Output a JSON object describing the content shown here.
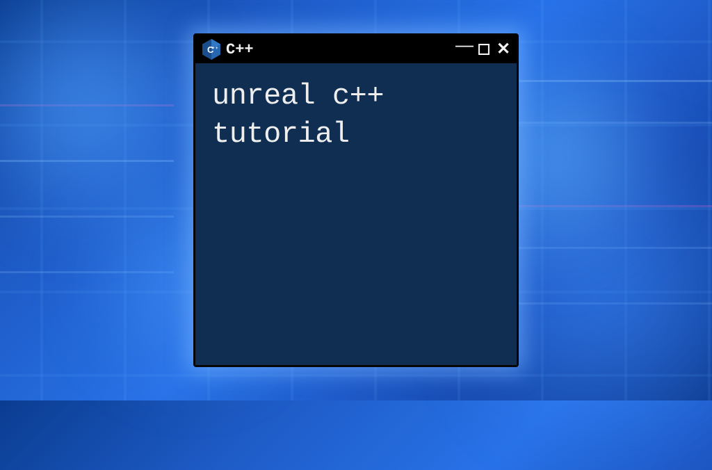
{
  "window": {
    "title": "C++",
    "icon_name": "cpp-hex-icon"
  },
  "content": {
    "text": "unreal c++\ntutorial"
  },
  "colors": {
    "titlebar_bg": "#000000",
    "content_bg": "#0f2e52",
    "text": "#eeeeee",
    "glow": "#78b4ff"
  }
}
